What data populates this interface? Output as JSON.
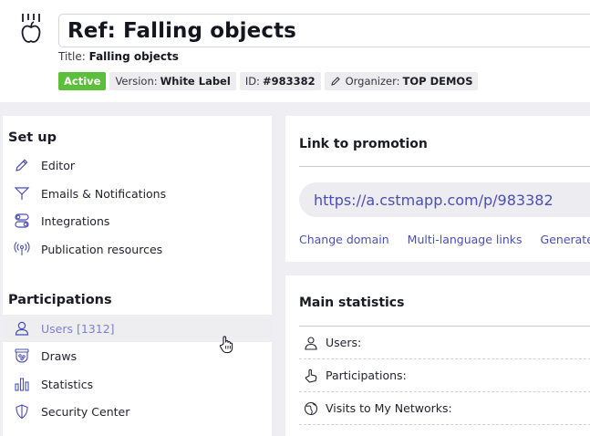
{
  "header": {
    "title": "Ref: Falling objects",
    "subtitle_label": "Title:",
    "subtitle_value": "Falling objects",
    "badges": {
      "status": "Active",
      "version_label": "Version:",
      "version_value": "White Label",
      "id_label": "ID:",
      "id_value": "#983382",
      "organizer_label": "Organizer:",
      "organizer_value": "TOP DEMOS"
    }
  },
  "sidebar": {
    "setup_title": "Set up",
    "setup_items": [
      {
        "label": "Editor",
        "icon": "pencil-icon"
      },
      {
        "label": "Emails & Notifications",
        "icon": "paper-plane-icon"
      },
      {
        "label": "Integrations",
        "icon": "toggles-icon"
      },
      {
        "label": "Publication resources",
        "icon": "broadcast-icon"
      }
    ],
    "participations_title": "Participations",
    "participation_items": [
      {
        "label": "Users [1312]",
        "icon": "user-icon",
        "selected": true
      },
      {
        "label": "Draws",
        "icon": "draw-drum-icon"
      },
      {
        "label": "Statistics",
        "icon": "bar-chart-icon"
      },
      {
        "label": "Security Center",
        "icon": "shield-icon"
      }
    ]
  },
  "promotion": {
    "title": "Link to promotion",
    "url": "https://a.cstmapp.com/p/983382",
    "links": [
      "Change domain",
      "Multi-language links",
      "Generate QR"
    ]
  },
  "statistics": {
    "title": "Main statistics",
    "rows": [
      {
        "label": "Users:",
        "icon": "user-icon"
      },
      {
        "label": "Participations:",
        "icon": "hand-pointer-icon"
      },
      {
        "label": "Visits to My Networks:",
        "icon": "globe-icon"
      }
    ]
  },
  "colors": {
    "accent": "#4a4fb0",
    "active_badge": "#5bbf3a",
    "background": "#efeff3"
  }
}
